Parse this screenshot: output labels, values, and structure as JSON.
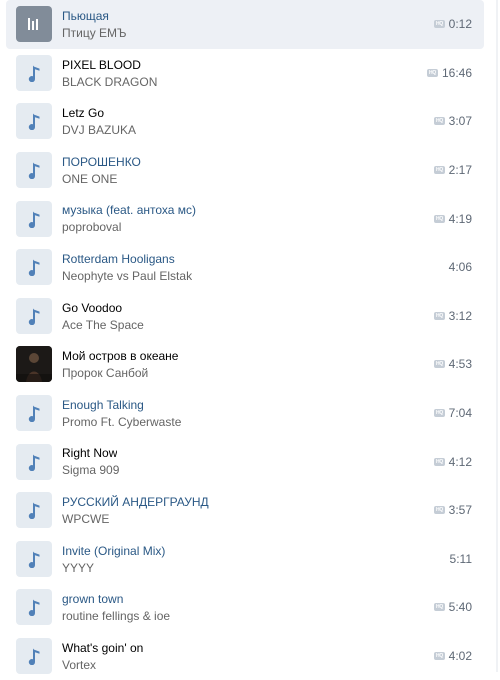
{
  "tracks": [
    {
      "title": "Пьющая",
      "artist": "Птицу ЕМЪ",
      "duration": "0:12",
      "hq": true,
      "active": true,
      "link": true,
      "cover": "playing-bars-icon"
    },
    {
      "title": "PIXEL BLOOD",
      "artist": "BLACK DRAGON",
      "duration": "16:46",
      "hq": true,
      "active": false,
      "link": false,
      "cover": "music-note-icon"
    },
    {
      "title": "Letz Go",
      "artist": "DVJ BAZUKA",
      "duration": "3:07",
      "hq": true,
      "active": false,
      "link": false,
      "cover": "music-note-icon"
    },
    {
      "title": "ПОРОШЕНКО",
      "artist": "ONE ONE",
      "duration": "2:17",
      "hq": true,
      "active": false,
      "link": true,
      "cover": "music-note-icon"
    },
    {
      "title": "музыка (feat. антоха мс)",
      "artist": "poproboval",
      "duration": "4:19",
      "hq": true,
      "active": false,
      "link": true,
      "cover": "music-note-icon"
    },
    {
      "title": "Rotterdam Hooligans",
      "artist": "Neophyte vs Paul Elstak",
      "duration": "4:06",
      "hq": false,
      "active": false,
      "link": true,
      "cover": "music-note-icon"
    },
    {
      "title": "Go Voodoo",
      "artist": "Ace The Space",
      "duration": "3:12",
      "hq": true,
      "active": false,
      "link": false,
      "cover": "music-note-icon"
    },
    {
      "title": "Мой остров в океане",
      "artist": "Пророк Санбой",
      "duration": "4:53",
      "hq": true,
      "active": false,
      "link": false,
      "cover": "album-art"
    },
    {
      "title": "Enough Talking",
      "artist": "Promo Ft. Cyberwaste",
      "duration": "7:04",
      "hq": true,
      "active": false,
      "link": true,
      "cover": "music-note-icon"
    },
    {
      "title": "Right Now",
      "artist": "Sigma 909",
      "duration": "4:12",
      "hq": true,
      "active": false,
      "link": false,
      "cover": "music-note-icon"
    },
    {
      "title": "РУССКИЙ АНДЕРГРАУНД",
      "artist": "WPCWE",
      "duration": "3:57",
      "hq": true,
      "active": false,
      "link": true,
      "cover": "music-note-icon"
    },
    {
      "title": "Invite (Original Mix)",
      "artist": "YYYY",
      "duration": "5:11",
      "hq": false,
      "active": false,
      "link": true,
      "cover": "music-note-icon"
    },
    {
      "title": "grown town",
      "artist": "routine fellings & ioe",
      "duration": "5:40",
      "hq": true,
      "active": false,
      "link": true,
      "cover": "music-note-icon"
    },
    {
      "title": "What's goin' on",
      "artist": "Vortex",
      "duration": "4:02",
      "hq": true,
      "active": false,
      "link": false,
      "cover": "music-note-icon"
    }
  ],
  "hq_label": "HQ",
  "colors": {
    "link": "#2a5885",
    "text": "#000000",
    "muted": "#656565",
    "active_bg": "#edf0f5",
    "cover_bg": "#e5ebf1",
    "note": "#5181b8"
  }
}
